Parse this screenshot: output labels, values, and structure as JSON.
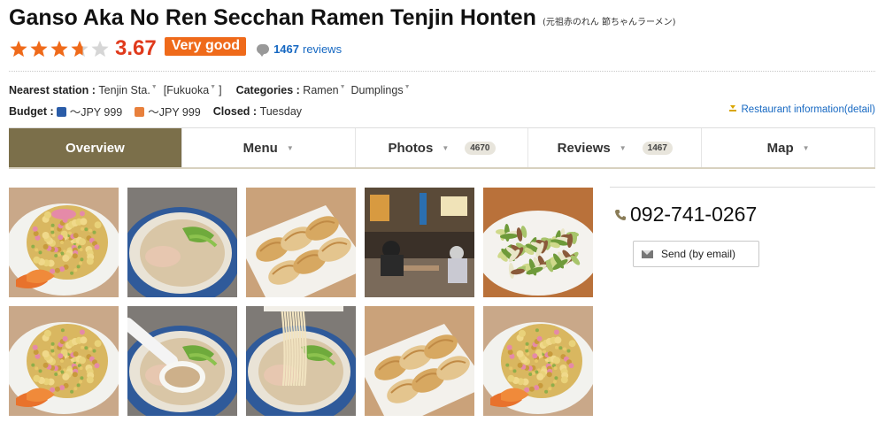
{
  "restaurant": {
    "name": "Ganso Aka No Ren Secchan Ramen Tenjin Honten",
    "name_jp": "(元祖赤のれん 節ちゃんラーメン)"
  },
  "rating": {
    "stars": 3.67,
    "score": "3.67",
    "verdict": "Very good",
    "review_count": "1467",
    "review_word": "reviews",
    "star_color": "#ef6a1a"
  },
  "info": {
    "station_label": "Nearest station",
    "station": "Tenjin Sta.",
    "area": "[Fukuoka",
    "area_close": "]",
    "categories_label": "Categories",
    "category_1": "Ramen",
    "category_2": "Dumplings",
    "budget_label": "Budget",
    "budget_dinner": "～JPY 999",
    "budget_lunch": "～JPY 999",
    "closed_label": "Closed",
    "closed": "Tuesday",
    "detail_link": "Restaurant information(detail)"
  },
  "tabs": [
    {
      "label": "Overview",
      "count": ""
    },
    {
      "label": "Menu",
      "count": ""
    },
    {
      "label": "Photos",
      "count": "4670"
    },
    {
      "label": "Reviews",
      "count": "1467"
    },
    {
      "label": "Map",
      "count": ""
    }
  ],
  "photos": [
    "fried-rice-photo",
    "ramen-bowl-photo",
    "gyoza-plate-photo",
    "restaurant-interior-photo",
    "stir-fry-plate-photo",
    "fried-rice-photo",
    "ramen-spoon-photo",
    "ramen-noodles-lift-photo",
    "gyoza-plate-photo",
    "fried-rice-photo"
  ],
  "contact": {
    "phone": "092-741-0267",
    "send_label": "Send (by email)"
  },
  "colors": {
    "accent": "#7b6f4a",
    "score_red": "#e03a1c",
    "link_blue": "#1668c2",
    "badge_orange": "#ef6a1a"
  }
}
